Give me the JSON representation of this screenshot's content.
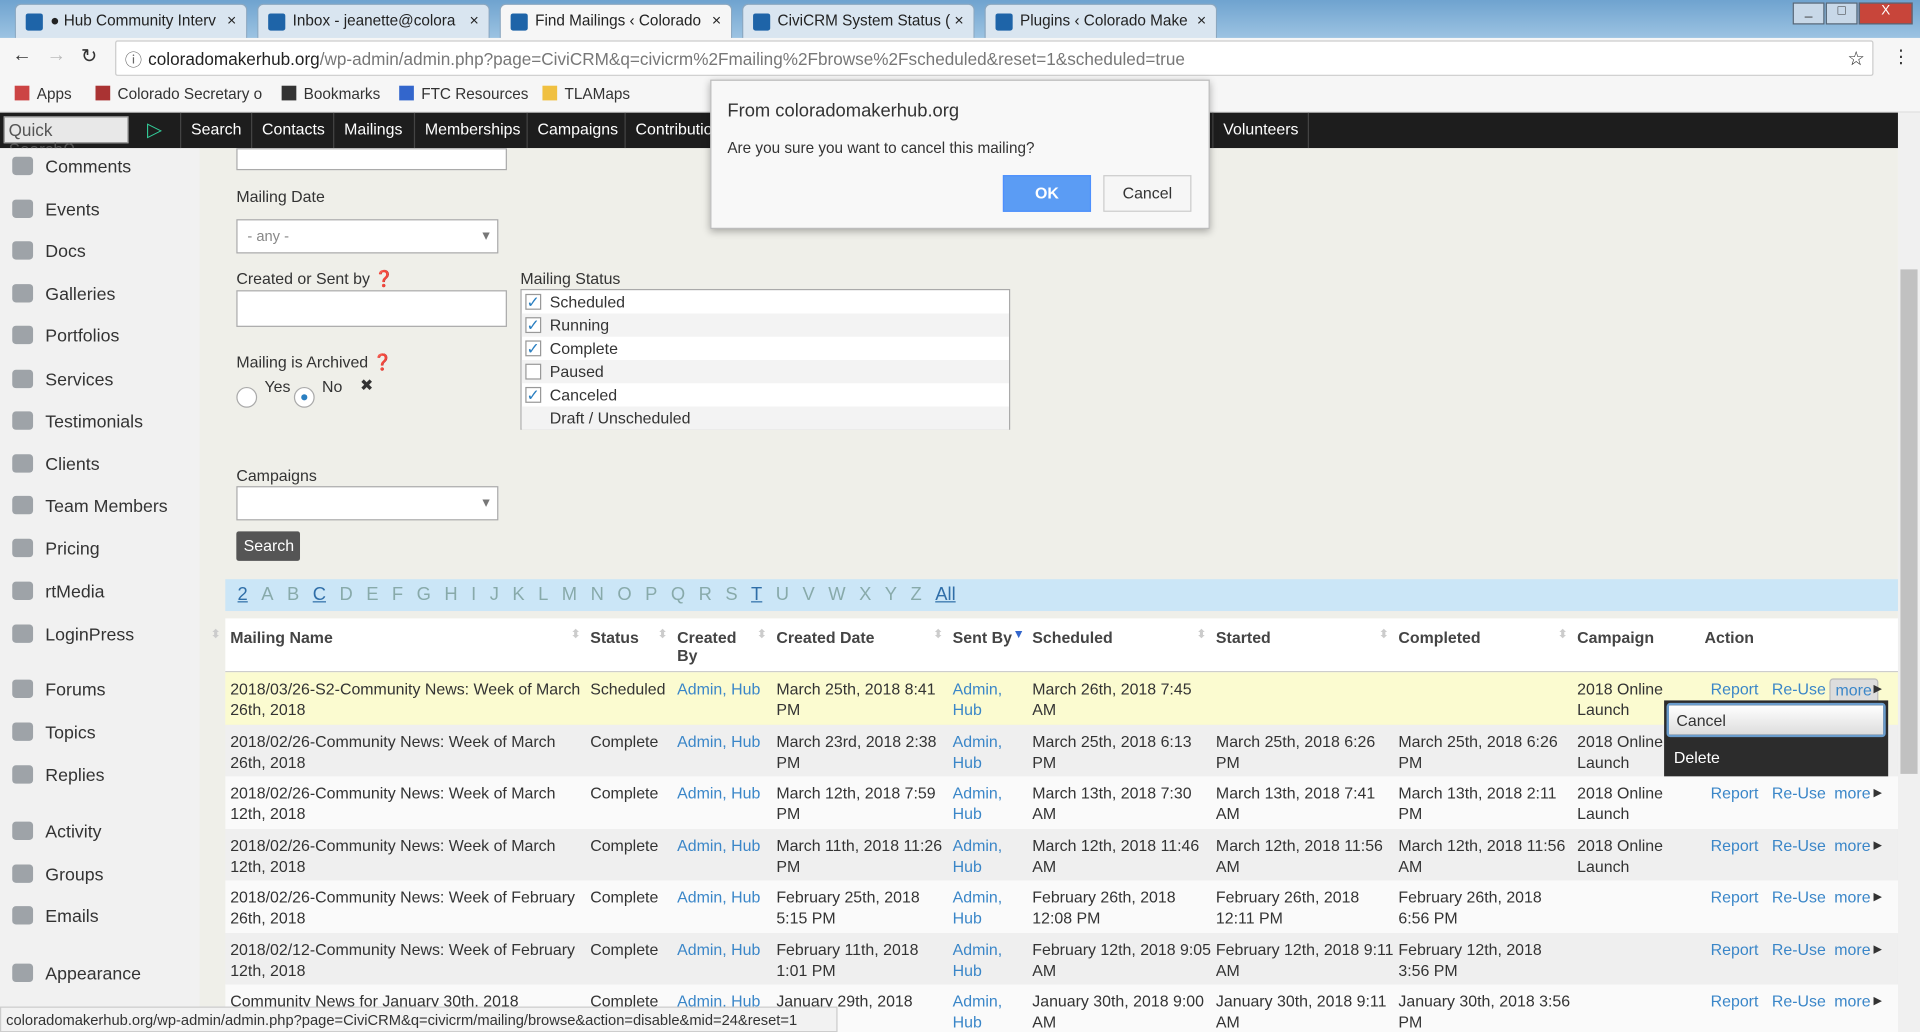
{
  "browser": {
    "tabs": [
      {
        "label": "● Hub Community Interv",
        "icon": "hub-icon"
      },
      {
        "label": "Inbox - jeanette@colora",
        "icon": "gmail-icon"
      },
      {
        "label": "Find Mailings ‹ Colorado",
        "icon": "civicrm-icon",
        "active": true
      },
      {
        "label": "CiviCRM System Status (",
        "icon": "civicrm-icon"
      },
      {
        "label": "Plugins ‹ Colorado Make",
        "icon": "civicrm-icon"
      }
    ],
    "url_host": "coloradomakerhub.org",
    "url_rest": "/wp-admin/admin.php?page=CiviCRM&q=civicrm%2Fmailing%2Fbrowse%2Fscheduled&reset=1&scheduled=true",
    "bookmarks": [
      "Apps",
      "Colorado Secretary o",
      "Bookmarks",
      "FTC Resources",
      "TLAMaps"
    ],
    "status_url": "coloradomakerhub.org/wp-admin/admin.php?page=CiviCRM&q=civicrm/mailing/browse&action=disable&mid=24&reset=1"
  },
  "admin_nav": {
    "quick_search": "Quick Search",
    "items": [
      "Search",
      "Contacts",
      "Mailings",
      "Memberships",
      "Campaigns",
      "Contributio",
      "Volunteers"
    ]
  },
  "sidebar": [
    "Comments",
    "Events",
    "Docs",
    "Galleries",
    "Portfolios",
    "Services",
    "Testimonials",
    "Clients",
    "Team Members",
    "Pricing",
    "rtMedia",
    "LoginPress",
    "Forums",
    "Topics",
    "Replies",
    "Activity",
    "Groups",
    "Emails",
    "Appearance"
  ],
  "form": {
    "mailing_date_label": "Mailing Date",
    "mailing_date_value": "- any -",
    "created_by_label": "Created or Sent by",
    "archived_label": "Mailing is Archived",
    "yes": "Yes",
    "no": "No",
    "archived_selected": "No",
    "status_label": "Mailing Status",
    "statuses": [
      {
        "label": "Scheduled",
        "checked": true
      },
      {
        "label": "Running",
        "checked": true
      },
      {
        "label": "Complete",
        "checked": true
      },
      {
        "label": "Paused",
        "checked": false
      },
      {
        "label": "Canceled",
        "checked": true
      },
      {
        "label": "Draft / Unscheduled",
        "checked": false
      }
    ],
    "campaigns_label": "Campaigns",
    "search_button": "Search"
  },
  "alpha": [
    "2",
    "A",
    "B",
    "C",
    "D",
    "E",
    "F",
    "G",
    "H",
    "I",
    "J",
    "K",
    "L",
    "M",
    "N",
    "O",
    "P",
    "Q",
    "R",
    "S",
    "T",
    "U",
    "V",
    "W",
    "X",
    "Y",
    "Z",
    "All"
  ],
  "alpha_active": [
    "2",
    "C",
    "T",
    "All"
  ],
  "table": {
    "headers": [
      "Mailing Name",
      "Status",
      "Created By",
      "Created Date",
      "Sent By",
      "Scheduled",
      "Started",
      "Completed",
      "Campaign",
      "Action"
    ],
    "actions": [
      "Report",
      "Re-Use",
      "more"
    ],
    "rows": [
      [
        "2018/03/26-S2-Community News: Week of March 26th, 2018",
        "Scheduled",
        "Admin, Hub",
        "March 25th, 2018 8:41 PM",
        "Admin, Hub",
        "March 26th, 2018 7:45 AM",
        "",
        "",
        "2018 Online Launch"
      ],
      [
        "2018/02/26-Community News: Week of March 26th, 2018",
        "Complete",
        "Admin, Hub",
        "March 23rd, 2018 2:38 PM",
        "Admin, Hub",
        "March 25th, 2018 6:13 PM",
        "March 25th, 2018 6:26 PM",
        "March 25th, 2018 6:26 PM",
        "2018 Online Launch"
      ],
      [
        "2018/02/26-Community News: Week of March 12th, 2018",
        "Complete",
        "Admin, Hub",
        "March 12th, 2018 7:59 PM",
        "Admin, Hub",
        "March 13th, 2018 7:30 AM",
        "March 13th, 2018 7:41 AM",
        "March 13th, 2018 2:11 PM",
        "2018 Online Launch"
      ],
      [
        "2018/02/26-Community News: Week of March 12th, 2018",
        "Complete",
        "Admin, Hub",
        "March 11th, 2018 11:26 PM",
        "Admin, Hub",
        "March 12th, 2018 11:46 AM",
        "March 12th, 2018 11:56 AM",
        "March 12th, 2018 11:56 AM",
        "2018 Online Launch"
      ],
      [
        "2018/02/26-Community News: Week of February 26th, 2018",
        "Complete",
        "Admin, Hub",
        "February 25th, 2018 5:15 PM",
        "Admin, Hub",
        "February 26th, 2018 12:08 PM",
        "February 26th, 2018 12:11 PM",
        "February 26th, 2018 6:56 PM",
        ""
      ],
      [
        "2018/02/12-Community News: Week of February 12th, 2018",
        "Complete",
        "Admin, Hub",
        "February 11th, 2018 1:01 PM",
        "Admin, Hub",
        "February 12th, 2018 9:05 AM",
        "February 12th, 2018 9:11 AM",
        "February 12th, 2018 3:56 PM",
        ""
      ],
      [
        "Community News for January 30th, 2018",
        "Complete",
        "Admin, Hub",
        "January 29th, 2018",
        "Admin, Hub",
        "January 30th, 2018 9:00 AM",
        "January 30th, 2018 9:11 AM",
        "January 30th, 2018 3:56 PM",
        ""
      ]
    ]
  },
  "more_menu": [
    "Cancel",
    "Delete"
  ],
  "dialog": {
    "title": "From coloradomakerhub.org",
    "message": "Are you sure you want to cancel this mailing?",
    "ok": "OK",
    "cancel": "Cancel"
  },
  "colors": {
    "accent": "#4d90fe",
    "highlight_row": "#fbfbd0",
    "link": "#3a86c8"
  }
}
